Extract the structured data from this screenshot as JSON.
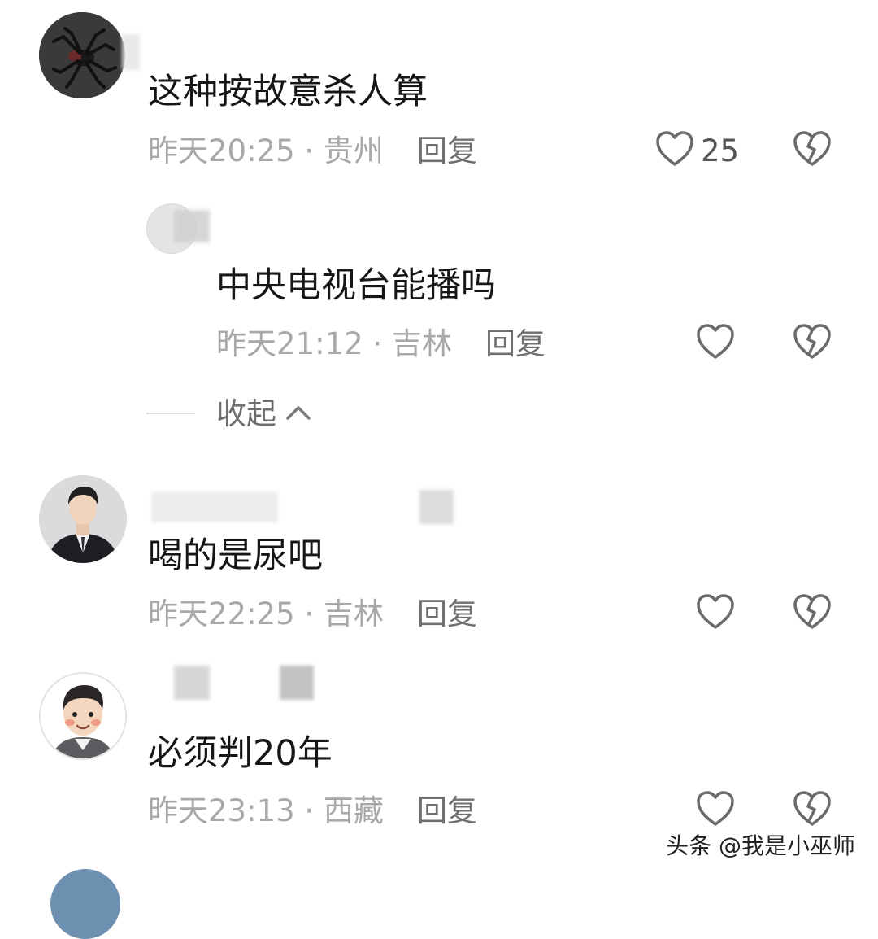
{
  "comments": [
    {
      "text": "这种按故意杀人算",
      "time_location": "昨天20:25 · 贵州",
      "reply_label": "回复",
      "like_count": "25",
      "avatar_icon": "spider-avatar-icon"
    },
    {
      "text": "中央电视台能播吗",
      "time_location": "昨天21:12 · 吉林",
      "reply_label": "回复",
      "avatar_icon": "avatar-icon"
    },
    {
      "text": "喝的是尿吧",
      "time_location": "昨天22:25 · 吉林",
      "reply_label": "回复",
      "avatar_icon": "man-in-suit-avatar-icon"
    },
    {
      "text": "必须判20年",
      "time_location": "昨天23:13 · 西藏",
      "reply_label": "回复",
      "avatar_icon": "cartoon-man-avatar-icon"
    }
  ],
  "collapse_label": "收起",
  "watermark": "头条 @我是小巫师",
  "colors": {
    "text_primary": "#161616",
    "text_meta": "#a8a8a8",
    "icon_stroke": "#6a6a6a"
  }
}
